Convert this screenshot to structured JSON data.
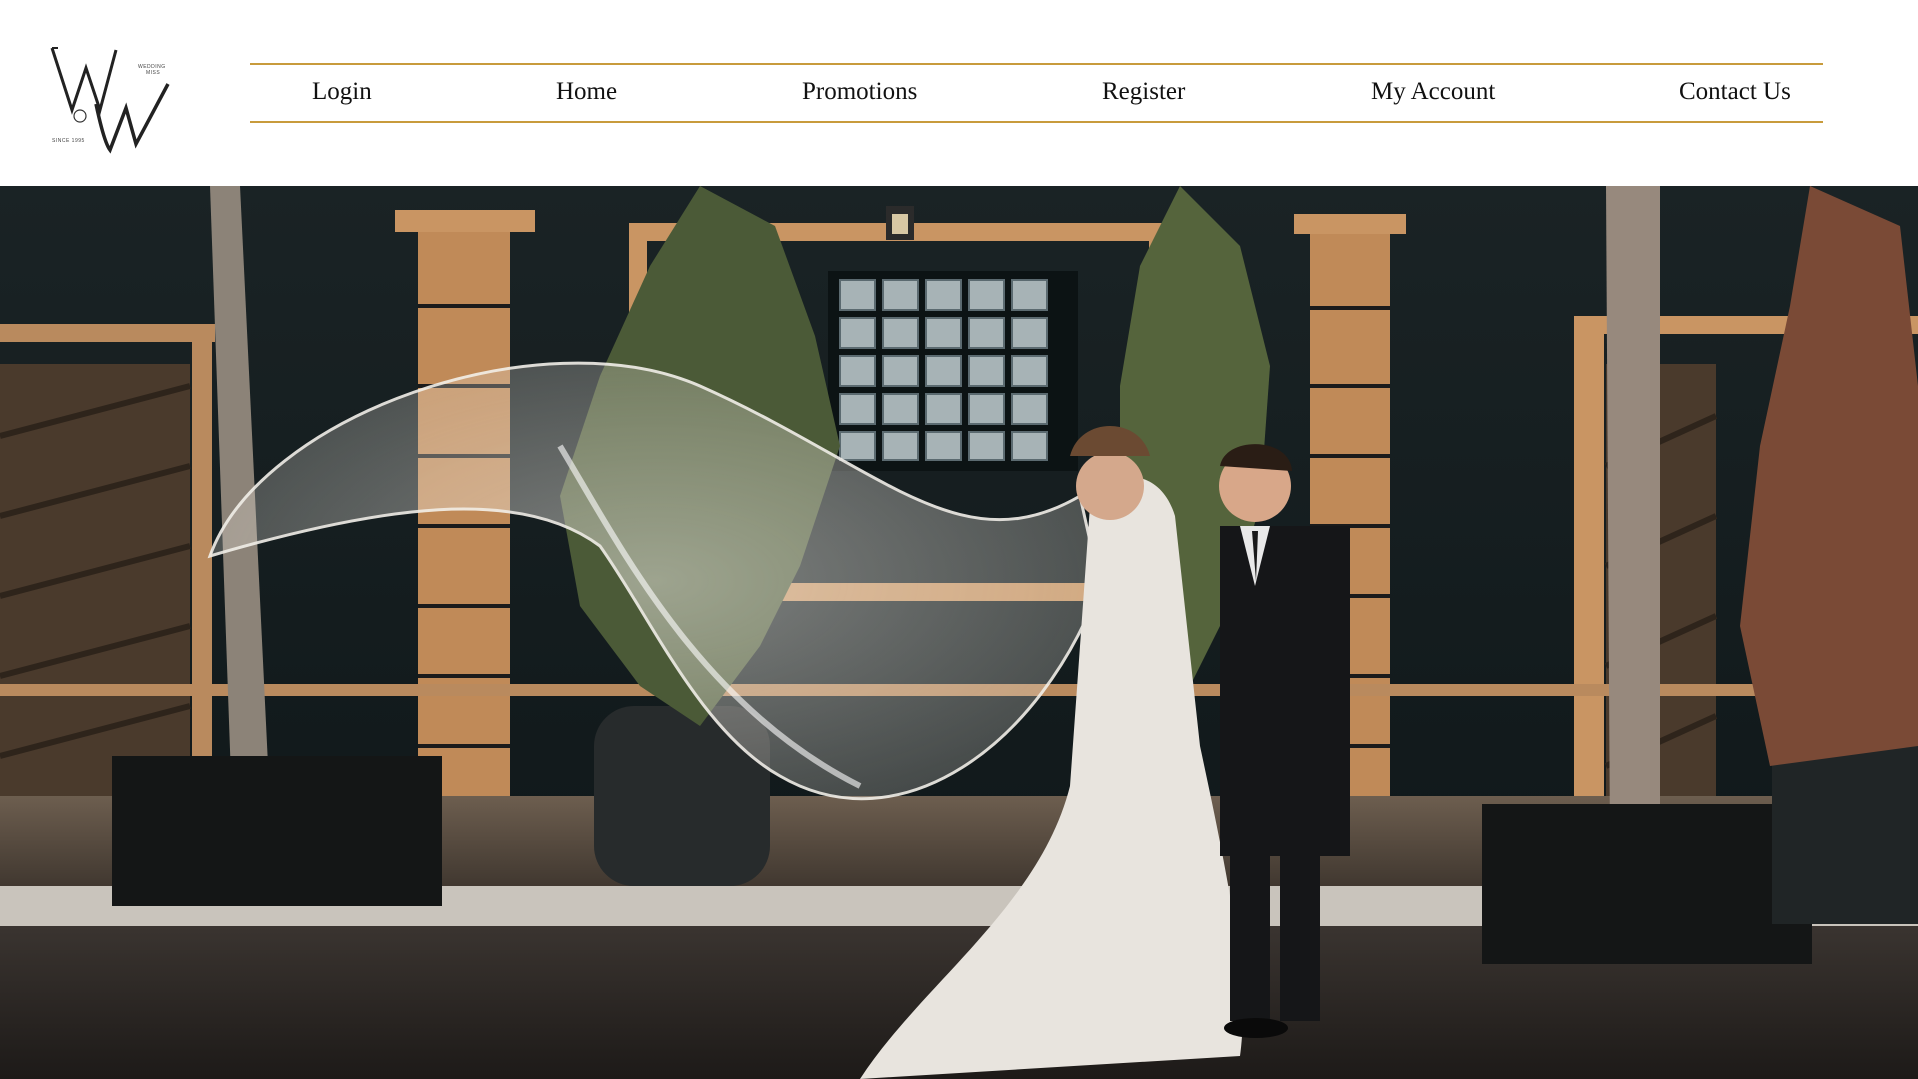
{
  "brand": {
    "logo_letters": "WW",
    "logo_tagline": "WEDDING MISS",
    "logo_since": "SINCE 1995"
  },
  "nav": {
    "items": [
      {
        "label": "Login"
      },
      {
        "label": "Home"
      },
      {
        "label": "Promotions"
      },
      {
        "label": "Register"
      },
      {
        "label": "My Account"
      },
      {
        "label": "Contact Us"
      }
    ],
    "accent_color": "#c89b3c"
  },
  "hero": {
    "subject": "bride-and-groom-photo"
  }
}
